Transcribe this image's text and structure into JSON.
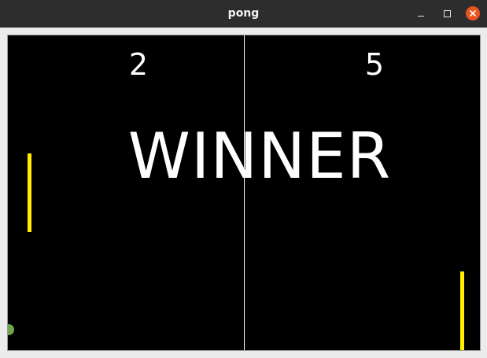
{
  "window": {
    "title": "pong",
    "controls": [
      "minimize",
      "maximize",
      "close"
    ],
    "close_color": "#e95420"
  },
  "game": {
    "score_left": "2",
    "score_right": "5",
    "message": "WINNER",
    "paddle_color": "#ffee00",
    "ball_color": "#6fa84a",
    "background": "#000000",
    "net_color": "#ffffff"
  }
}
